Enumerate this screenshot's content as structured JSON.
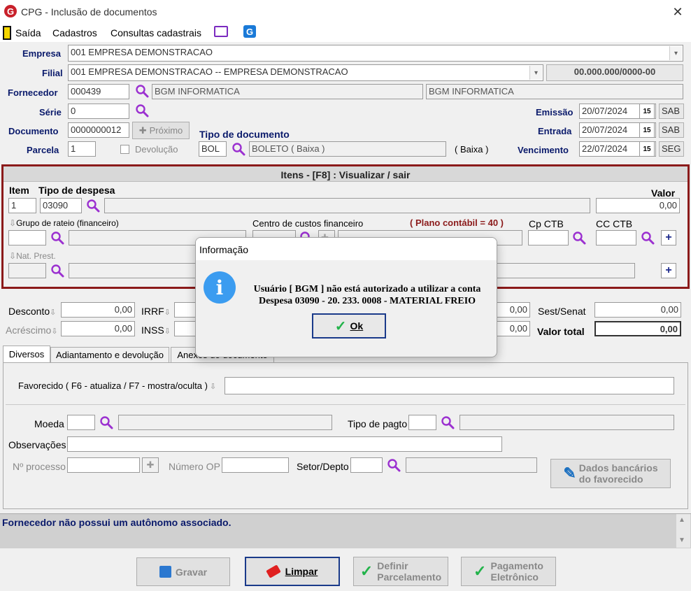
{
  "window": {
    "title": "CPG - Inclusão de documentos",
    "logo": "G"
  },
  "menu": {
    "saida": "Saída",
    "cadastros": "Cadastros",
    "consultas": "Consultas cadastrais"
  },
  "header": {
    "empresa_label": "Empresa",
    "empresa_value": "001 EMPRESA DEMONSTRACAO",
    "filial_label": "Filial",
    "filial_value": "001 EMPRESA DEMONSTRACAO -- EMPRESA DEMONSTRACAO",
    "cnpj": "00.000.000/0000-00",
    "fornecedor_label": "Fornecedor",
    "fornecedor_code": "000439",
    "fornecedor_name1": "BGM INFORMATICA",
    "fornecedor_name2": "BGM INFORMATICA",
    "serie_label": "Série",
    "serie_value": "0",
    "documento_label": "Documento",
    "documento_value": "0000000012",
    "proximo": "Próximo",
    "tipo_doc_label": "Tipo de documento",
    "tipo_doc_code": "BOL",
    "tipo_doc_desc": "BOLETO ( Baixa )",
    "tipo_doc_extra": "( Baixa )",
    "parcela_label": "Parcela",
    "parcela_value": "1",
    "devolucao": "Devolução",
    "emissao_label": "Emissão",
    "emissao_value": "20/07/2024",
    "emissao_day": "SAB",
    "entrada_label": "Entrada",
    "entrada_value": "20/07/2024",
    "entrada_day": "SAB",
    "vencimento_label": "Vencimento",
    "vencimento_value": "22/07/2024",
    "vencimento_day": "SEG",
    "cal_glyph": "15"
  },
  "itens": {
    "title": "Itens  - [F8] : Visualizar / sair",
    "item_label": "Item",
    "tipo_despesa_label": "Tipo de despesa",
    "valor_label": "Valor",
    "item_value": "1",
    "despesa_code": "03090",
    "valor_value": "0,00",
    "grupo_rateio": "Grupo de rateio (financeiro)",
    "centro_custos": "Centro de custos financeiro",
    "plano_contabil": "( Plano contábil = 40 )",
    "cp_ctb": "Cp CTB",
    "cc_ctb": "CC CTB",
    "nat_prest": "Nat. Prest."
  },
  "totals": {
    "desconto_label": "Desconto",
    "desconto_value": "0,00",
    "acrescimo_label": "Acréscimo",
    "acrescimo_value": "0,00",
    "irrf_label": "IRRF",
    "inss_label": "INSS",
    "mid_value1": "0,00",
    "mid_value2": "0,00",
    "sest_label": "Sest/Senat",
    "sest_value": "0,00",
    "total_label": "Valor total",
    "total_value": "0,00"
  },
  "tabs": [
    {
      "label": "Diversos"
    },
    {
      "label": "Adiantamento e devolução"
    },
    {
      "label": "Anexos do documento"
    }
  ],
  "diversos": {
    "favorecido_label": "Favorecido ( F6 - atualiza / F7 - mostra/oculta )",
    "moeda_label": "Moeda",
    "tipo_pagto_label": "Tipo de pagto",
    "observacoes_label": "Observações",
    "processo_label": "Nº processo",
    "numero_op_label": "Número OP",
    "setor_label": "Setor/Depto",
    "dados_bancarios_1": "Dados bancários",
    "dados_bancarios_2": "do favorecido"
  },
  "status": {
    "message": "Fornecedor não possui um autônomo associado."
  },
  "buttons": {
    "gravar": "Gravar",
    "limpar": "Limpar",
    "definir_1": "Definir",
    "definir_2": "Parcelamento",
    "pagamento_1": "Pagamento",
    "pagamento_2": "Eletrônico"
  },
  "dialog": {
    "title": "Informação",
    "line1": "Usuário [ BGM ] não está autorizado a utilizar a conta",
    "line2": "Despesa 03090 - 20. 233. 0008 - MATERIAL FREIO",
    "ok": "Ok"
  },
  "colors": {
    "accent": "#8b1a1a",
    "navy": "#0a1a6b",
    "magnifier": "#9b30d0",
    "info_blue": "#3b9cf0"
  }
}
